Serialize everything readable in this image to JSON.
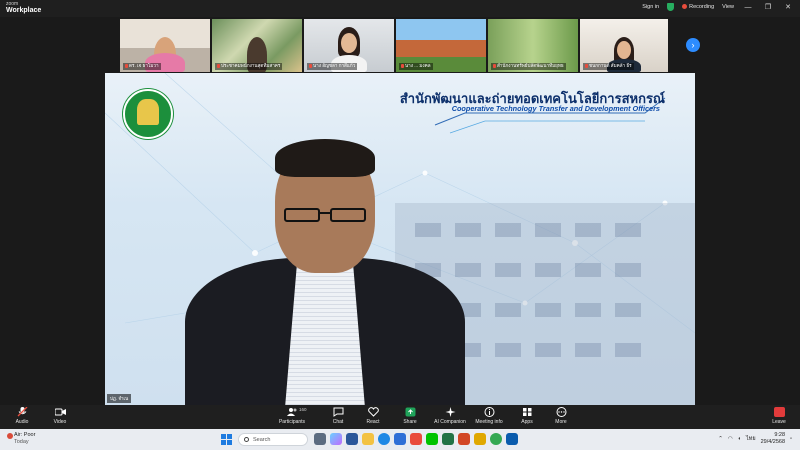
{
  "window": {
    "app_small": "zoom",
    "app_name": "Workplace",
    "sign_in": "Sign in",
    "recording": "Recording",
    "view": "View",
    "min": "—",
    "restore": "❐",
    "close": "✕"
  },
  "gallery": [
    {
      "name": "ดร. เจ ธาโมวา"
    },
    {
      "name": "ประชาคมพนักงานสุดทีมสาคร"
    },
    {
      "name": "นาง อัญชลา กาสีแก้ว"
    },
    {
      "name": "นาง ... มงคล"
    },
    {
      "name": "สำนักงานทรัพย์ปลัดพัฒนาทีมยุทธ"
    },
    {
      "name": "ชนกกานต์ สัมคล้า ธีร"
    }
  ],
  "next_page": "›",
  "main": {
    "org_thai": "สำนักพัฒนาและถ่ายทอดเทคโนโลยีการสหกรณ์",
    "org_english": "Cooperative Technology Transfer and Development Officers",
    "speaker_tag": "ปฏ. จำเน"
  },
  "controls": {
    "audio": "Audio",
    "video": "Video",
    "participants": "Participants",
    "participants_count": "160",
    "chat": "Chat",
    "react": "React",
    "share": "Share",
    "ai_companion": "AI Companion",
    "meeting_info": "Meeting info",
    "apps": "Apps",
    "more": "More",
    "leave": "Leave"
  },
  "taskbar": {
    "weather_title": "Air: Poor",
    "weather_sub": "Today",
    "search_placeholder": "Search",
    "lang": "ไทย",
    "time": "9:28",
    "date": "29/4/2568"
  },
  "colors": {
    "accent_blue": "#2d8cff",
    "record_red": "#e74c3c",
    "secure_green": "#27ae60",
    "leave_red": "#e23b3b"
  }
}
